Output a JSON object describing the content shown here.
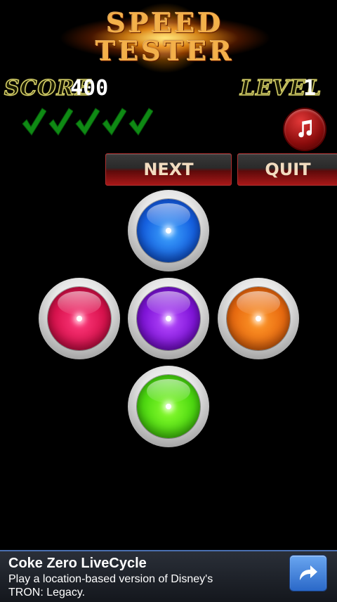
{
  "title": {
    "line1": "SPEED",
    "line2": "TESTER"
  },
  "hud": {
    "score_label": "SCORE",
    "score_value": "400",
    "level_label": "LEVEL",
    "level_value": "1",
    "checks_count": 5
  },
  "icons": {
    "check": "check-icon",
    "music": "music-note-icon",
    "ad_arrow": "share-arrow-icon"
  },
  "buttons": {
    "next": "NEXT",
    "quit": "QUIT"
  },
  "orbs": [
    {
      "name": "blue-orb-button",
      "color": "#1560e0"
    },
    {
      "name": "red-orb-button",
      "color": "#d8124d"
    },
    {
      "name": "purple-orb-button",
      "color": "#7f14d8"
    },
    {
      "name": "orange-orb-button",
      "color": "#e86a10"
    },
    {
      "name": "green-orb-button",
      "color": "#4cd810"
    }
  ],
  "ad": {
    "title": "Coke Zero LiveCycle",
    "text": "Play a location-based version of Disney's TRON: Legacy."
  }
}
